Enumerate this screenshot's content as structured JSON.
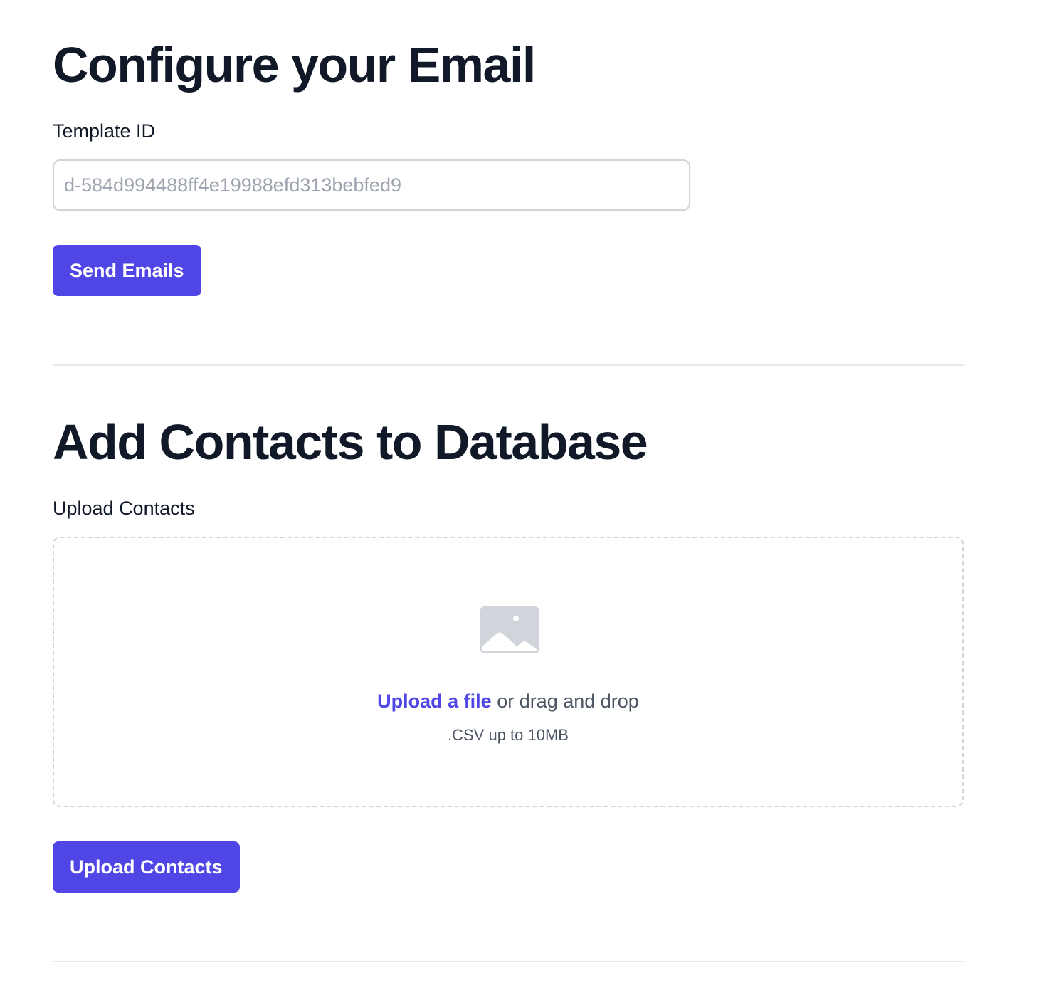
{
  "email_section": {
    "heading": "Configure your Email",
    "template_label": "Template ID",
    "template_placeholder": "d-584d994488ff4e19988efd313bebfed9",
    "template_value": "",
    "send_button_label": "Send Emails"
  },
  "contacts_section": {
    "heading": "Add Contacts to Database",
    "upload_label": "Upload Contacts",
    "dropzone": {
      "icon": "image-icon",
      "link_text": "Upload a file",
      "rest_text": " or drag and drop",
      "hint": ".CSV up to 10MB"
    },
    "upload_button_label": "Upload Contacts"
  },
  "colors": {
    "accent": "#4f46e5",
    "heading": "#111827",
    "border": "#d1d5db",
    "placeholder": "#9ca3af",
    "divider": "#e5e7eb",
    "icon": "#d1d5db"
  }
}
